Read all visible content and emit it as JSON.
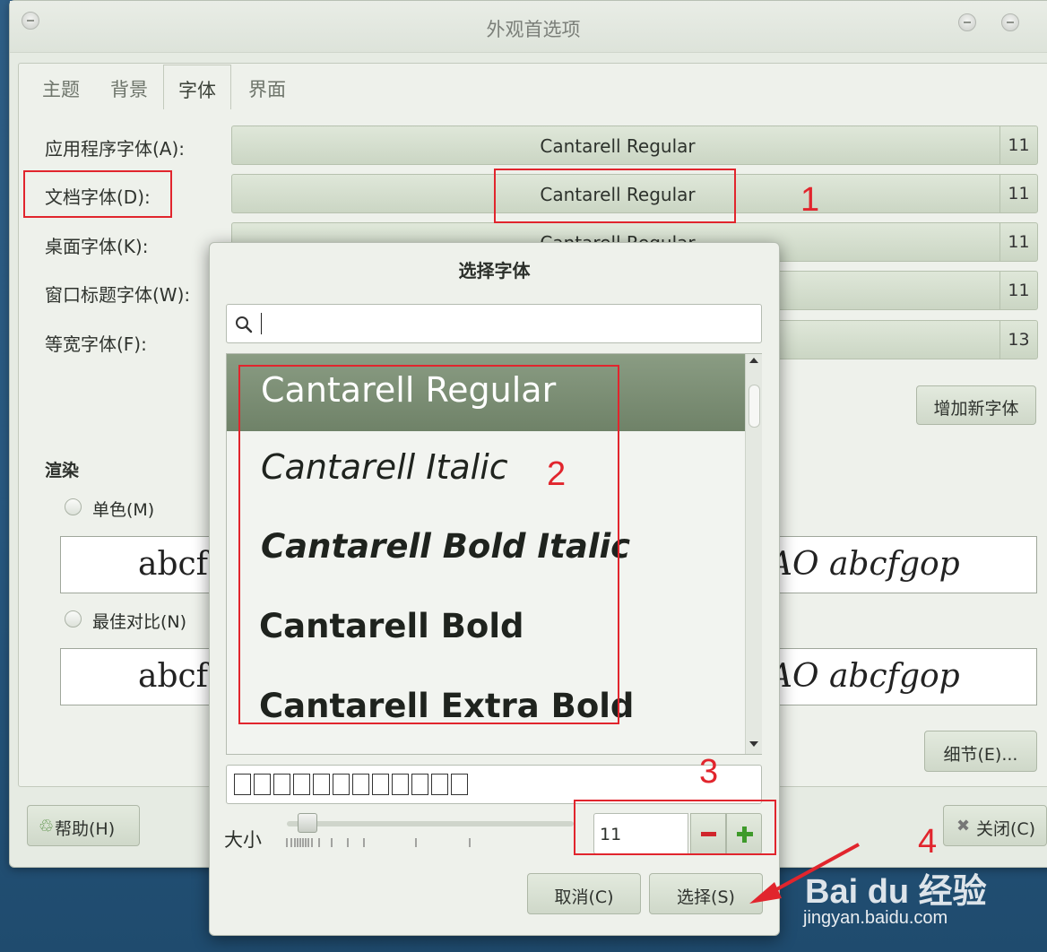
{
  "window": {
    "title": "外观首选项",
    "tabs": [
      "主题",
      "背景",
      "字体",
      "界面"
    ],
    "active_tab": "字体"
  },
  "fonts_tab": {
    "rows": [
      {
        "label": "应用程序字体(A):",
        "font": "Cantarell Regular",
        "size": "11"
      },
      {
        "label": "文档字体(D):",
        "font": "Cantarell Regular",
        "size": "11"
      },
      {
        "label": "桌面字体(K):",
        "font": "Cantarell Regular",
        "size": "11"
      },
      {
        "label": "窗口标题字体(W):",
        "font": "",
        "size": "11"
      },
      {
        "label": "等宽字体(F):",
        "font": "",
        "size": "13"
      }
    ],
    "add_font_button": "增加新字体",
    "rendering": {
      "title": "渲染",
      "options": [
        {
          "label": "单色(M)",
          "preview_left": "abcf",
          "preview_right": "AO abcfgop"
        },
        {
          "label": "最佳对比(N)",
          "preview_left": "abcf",
          "preview_right": "AO abcfgop"
        }
      ]
    },
    "details_button": "细节(E)...",
    "help_button": "帮助(H)",
    "close_button": "关闭(C)"
  },
  "dialog": {
    "title": "选择字体",
    "search": {
      "value": ""
    },
    "font_list": [
      {
        "name": "Cantarell Regular",
        "selected": true
      },
      {
        "name": "Cantarell Italic",
        "selected": false
      },
      {
        "name": "Cantarell Bold Italic",
        "selected": false
      },
      {
        "name": "Cantarell Bold",
        "selected": false
      },
      {
        "name": "Cantarell Extra Bold",
        "selected": false
      }
    ],
    "size_label": "大小",
    "size_value": "11",
    "size_slider_fraction": 0.03,
    "cancel_button": "取消(C)",
    "select_button": "选择(S)"
  },
  "annotations": [
    "1",
    "2",
    "3",
    "4"
  ],
  "watermark": {
    "logo": "Bai du 经验",
    "url": "jingyan.baidu.com"
  },
  "colors": {
    "selection": "#7a8c73",
    "annotation_red": "#e1252d",
    "window_bg": "#e6ebe3"
  }
}
